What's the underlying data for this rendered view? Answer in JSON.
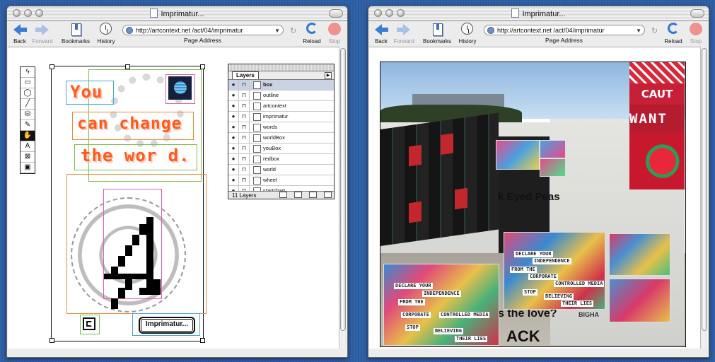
{
  "windows": [
    {
      "title": "Imprimatur...",
      "toolbar": {
        "back": "Back",
        "forward": "Forward",
        "bookmarks": "Bookmarks",
        "history": "History",
        "address_label": "Page Address",
        "reload": "Reload",
        "stop": "Stop"
      },
      "address": "http://artcontext.net /act/04/imprimatur"
    },
    {
      "title": "Imprimatur...",
      "toolbar": {
        "back": "Back",
        "forward": "Forward",
        "bookmarks": "Bookmarks",
        "history": "History",
        "address_label": "Page Address",
        "reload": "Reload",
        "stop": "Stop"
      },
      "address": "http://artcontext.net /act/04/imprimatur"
    }
  ],
  "editor": {
    "tools": [
      "lightning-tool",
      "rectangle-tool",
      "ellipse-tool",
      "line-tool",
      "bucket-tool",
      "pencil-tool",
      "hand-tool",
      "text-tool",
      "crossbox-tool",
      "save-tool"
    ],
    "tool_glyphs": [
      "ϟ",
      "▭",
      "◯",
      "╱",
      "⛁",
      "✎",
      "✋",
      "A",
      "⊠",
      "▣"
    ],
    "words": {
      "line1": "You",
      "line2": "can change",
      "line3": "the wor d."
    },
    "imprimatur_button": "Imprimatur...",
    "bbox_colors": {
      "green": "#7cc04a",
      "orange": "#f28a3a",
      "blue": "#48a8e0",
      "pink": "#e060b0"
    }
  },
  "layers_panel": {
    "tab": "Layers",
    "rows": [
      {
        "name": "box",
        "selected": true
      },
      {
        "name": "outline",
        "selected": false
      },
      {
        "name": "artcontext",
        "selected": false
      },
      {
        "name": "imprimatur",
        "selected": false
      },
      {
        "name": "words",
        "selected": false
      },
      {
        "name": "worldBox",
        "selected": false
      },
      {
        "name": "youBox",
        "selected": false
      },
      {
        "name": "redbox",
        "selected": false
      },
      {
        "name": "world",
        "selected": false
      },
      {
        "name": "wheel",
        "selected": false
      },
      {
        "name": "startchart",
        "selected": false
      }
    ],
    "footer": "11 Layers"
  },
  "photo": {
    "sticker_right": {
      "line1": "CAUT",
      "line2": "WANT"
    },
    "collage_text": [
      "DECLARE YOUR",
      "INDEPENDENCE",
      "FROM THE",
      "CORPORATE",
      "CONTROLLED MEDIA",
      "STOP",
      "BELIEVING",
      "THEIR LIES"
    ],
    "wall_text": {
      "eyed": "k Eyed Peas",
      "love": "s the love?",
      "ack": "ACK",
      "bigh": "BIGHA"
    },
    "colors": {
      "sticker_red": "#c71f35"
    }
  }
}
